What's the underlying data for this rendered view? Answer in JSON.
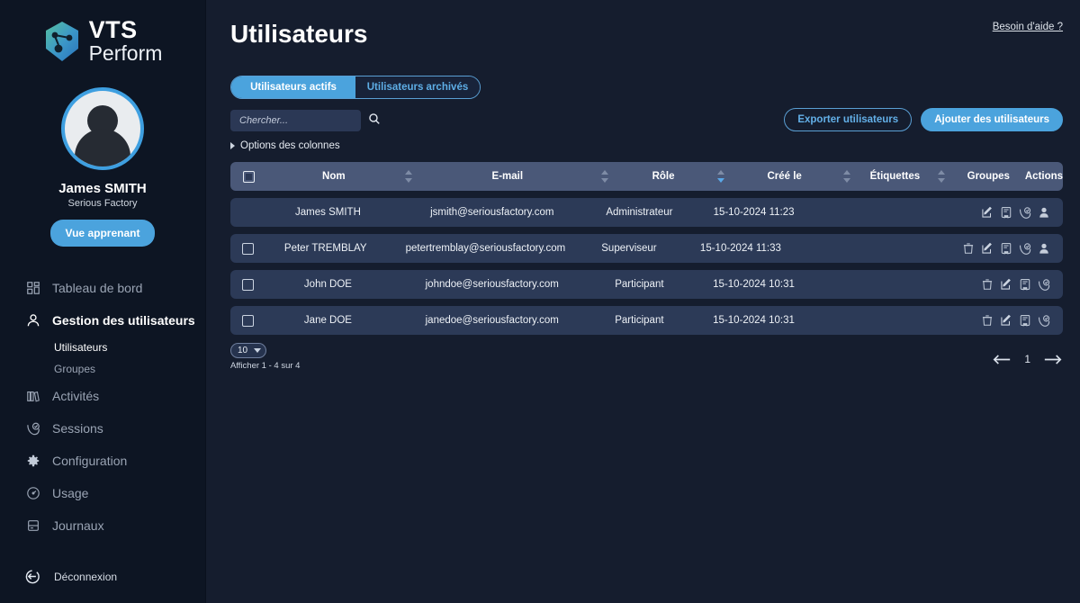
{
  "brand": {
    "line1": "VTS",
    "line2": "Perform",
    "logo_icon": "vts-hexagon-logo"
  },
  "profile": {
    "name": "James SMITH",
    "company": "Serious Factory",
    "view_button": "Vue apprenant",
    "avatar_icon": "user-avatar"
  },
  "sidebar": {
    "items": [
      {
        "label": "Tableau de bord",
        "icon": "dashboard-grid-icon",
        "active": false
      },
      {
        "label": "Gestion des utilisateurs",
        "icon": "user-icon",
        "active": true
      },
      {
        "label": "Activités",
        "icon": "books-icon",
        "active": false
      },
      {
        "label": "Sessions",
        "icon": "session-check-icon",
        "active": false
      },
      {
        "label": "Configuration",
        "icon": "gear-icon",
        "active": false
      },
      {
        "label": "Usage",
        "icon": "gauge-icon",
        "active": false
      },
      {
        "label": "Journaux",
        "icon": "logs-icon",
        "active": false
      }
    ],
    "subitems": [
      {
        "label": "Utilisateurs",
        "active": true
      },
      {
        "label": "Groupes",
        "active": false
      }
    ],
    "logout": {
      "label": "Déconnexion",
      "icon": "logout-icon"
    }
  },
  "header": {
    "title": "Utilisateurs",
    "help_link": "Besoin d'aide ?"
  },
  "tabs": [
    {
      "label": "Utilisateurs actifs",
      "active": true
    },
    {
      "label": "Utilisateurs archivés",
      "active": false
    }
  ],
  "search": {
    "placeholder": "Chercher...",
    "value": "",
    "icon": "search-icon"
  },
  "column_options": {
    "label": "Options des colonnes",
    "icon": "caret-right-icon"
  },
  "toolbar": {
    "export_label": "Exporter utilisateurs",
    "add_label": "Ajouter des utilisateurs"
  },
  "table": {
    "columns": [
      {
        "key": "check",
        "label": "",
        "sortable": false
      },
      {
        "key": "nom",
        "label": "Nom",
        "sortable": true,
        "sort": "none"
      },
      {
        "key": "email",
        "label": "E-mail",
        "sortable": true,
        "sort": "none"
      },
      {
        "key": "role",
        "label": "Rôle",
        "sortable": true,
        "sort": "desc"
      },
      {
        "key": "cree",
        "label": "Créé le",
        "sortable": true,
        "sort": "none"
      },
      {
        "key": "etiq",
        "label": "Étiquettes",
        "sortable": true,
        "sort": "none"
      },
      {
        "key": "groupes",
        "label": "Groupes",
        "sortable": false
      },
      {
        "key": "actions",
        "label": "Actions",
        "sortable": false
      }
    ],
    "rows": [
      {
        "selectable": false,
        "nom": "James SMITH",
        "email": "jsmith@seriousfactory.com",
        "role": "Administrateur",
        "cree": "15-10-2024 11:23",
        "etiquettes": "",
        "groupes": "",
        "actions": [
          "edit-icon",
          "certificate-icon",
          "session-check-icon",
          "person-icon"
        ]
      },
      {
        "selectable": true,
        "nom": "Peter TREMBLAY",
        "email": "petertremblay@seriousfactory.com",
        "role": "Superviseur",
        "cree": "15-10-2024 11:33",
        "etiquettes": "",
        "groupes": "",
        "actions": [
          "trash-icon",
          "edit-icon",
          "certificate-icon",
          "session-check-icon",
          "person-icon"
        ]
      },
      {
        "selectable": true,
        "nom": "John DOE",
        "email": "johndoe@seriousfactory.com",
        "role": "Participant",
        "cree": "15-10-2024 10:31",
        "etiquettes": "",
        "groupes": "",
        "actions": [
          "trash-icon",
          "edit-icon",
          "certificate-icon",
          "session-check-icon"
        ]
      },
      {
        "selectable": true,
        "nom": "Jane DOE",
        "email": "janedoe@seriousfactory.com",
        "role": "Participant",
        "cree": "15-10-2024 10:31",
        "etiquettes": "",
        "groupes": "",
        "actions": [
          "trash-icon",
          "edit-icon",
          "certificate-icon",
          "session-check-icon"
        ]
      }
    ]
  },
  "pagination": {
    "page_size": "10",
    "info": "Afficher 1 - 4 sur 4",
    "current_page": "1",
    "prev_icon": "arrow-left-icon",
    "next_icon": "arrow-right-icon"
  },
  "colors": {
    "app_bg": "#151d2e",
    "sidebar_bg": "#0d1523",
    "accent": "#4ba3dd",
    "table_header": "#4a5878",
    "table_row": "#2c3a57",
    "logo_gradient_from": "#4fb99a",
    "logo_gradient_to": "#2f7fc4"
  }
}
